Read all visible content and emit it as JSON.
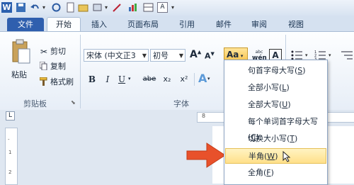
{
  "tabs": {
    "file": "文件",
    "home": "开始",
    "insert": "插入",
    "layout": "页面布局",
    "references": "引用",
    "mailings": "邮件",
    "review": "审阅",
    "view": "视图"
  },
  "clipboard": {
    "paste": "粘贴",
    "cut": "剪切",
    "copy": "复制",
    "format_painter": "格式刷",
    "group_label": "剪贴板"
  },
  "font": {
    "font_name": "宋体 (中文正3",
    "font_size": "初号",
    "group_label": "字体",
    "bold": "B",
    "italic": "I",
    "underline": "U",
    "strike": "abe",
    "subscript": "x₂",
    "superscript": "x²",
    "grow": "A",
    "shrink": "A",
    "change_case": "Aa",
    "pinyin": "wén",
    "border_char": "A"
  },
  "change_case_menu": {
    "items": [
      {
        "text": "句首字母大写",
        "key": "S"
      },
      {
        "text": "全部小写",
        "key": "L"
      },
      {
        "text": "全部大写",
        "key": "U"
      },
      {
        "text": "每个单词首字母大写",
        "key": "C"
      },
      {
        "text": "切换大小写",
        "key": "T"
      },
      {
        "text": "半角",
        "key": "W"
      },
      {
        "text": "全角",
        "key": "F"
      }
    ],
    "highlighted_index": 5
  },
  "ruler": {
    "mark_8": "8",
    "mark_6": "6",
    "v_mark_2": "2",
    "v_mark_1": "1",
    "tab_selector": "L"
  },
  "colors": {
    "file_tab": "#2f5fae",
    "highlight": "#ffe08a",
    "arrow": "#e8512b"
  }
}
